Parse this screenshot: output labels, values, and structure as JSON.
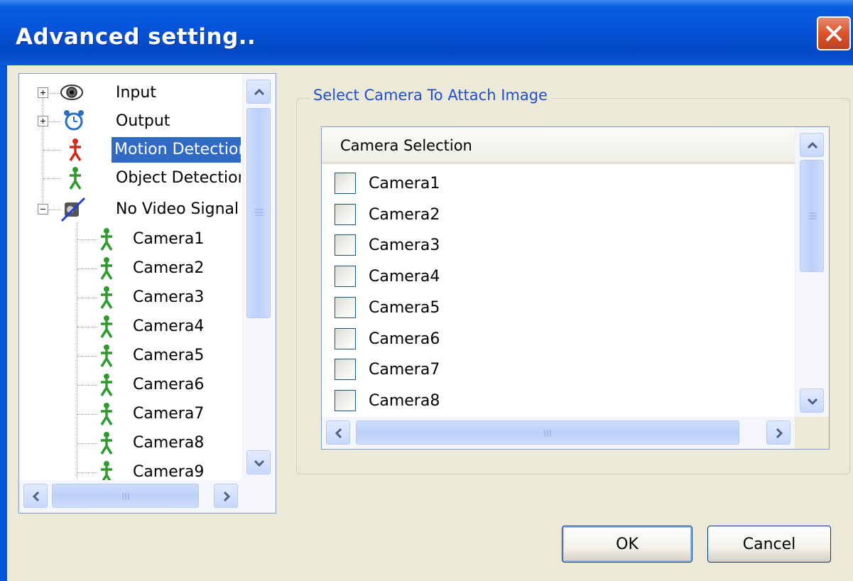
{
  "window": {
    "title": "Advanced setting..",
    "close_icon": "close-icon"
  },
  "tree": {
    "items": [
      {
        "label": "Input",
        "icon": "eye-icon",
        "expander": "plus"
      },
      {
        "label": "Output",
        "icon": "alarm-clock-icon",
        "expander": "plus"
      },
      {
        "label": "Motion Detection",
        "icon": "red-person-icon",
        "selected": true
      },
      {
        "label": "Object Detection",
        "icon": "green-person-icon"
      },
      {
        "label": "No Video Signal",
        "icon": "no-video-icon",
        "expander": "minus"
      }
    ],
    "children": [
      "Camera1",
      "Camera2",
      "Camera3",
      "Camera4",
      "Camera5",
      "Camera6",
      "Camera7",
      "Camera8",
      "Camera9"
    ]
  },
  "group": {
    "title": "Select Camera To Attach Image"
  },
  "list": {
    "header": "Camera Selection",
    "items": [
      "Camera1",
      "Camera2",
      "Camera3",
      "Camera4",
      "Camera5",
      "Camera6",
      "Camera7",
      "Camera8"
    ]
  },
  "buttons": {
    "ok": "OK",
    "cancel": "Cancel"
  },
  "colors": {
    "titlebar": "#0453d8",
    "selection": "#316ac5",
    "group_title": "#1f4fd1",
    "motion_icon": "#d42a1e",
    "camera_icon": "#2e9a2e"
  }
}
